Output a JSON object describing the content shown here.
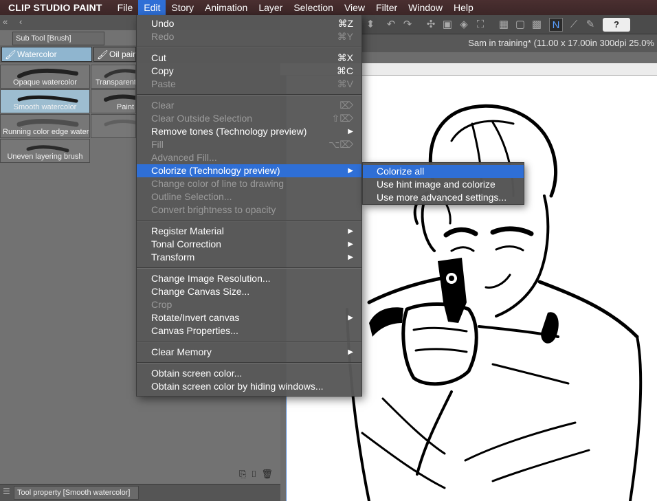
{
  "menubar": {
    "app_name": "CLIP STUDIO PAINT",
    "items": [
      "File",
      "Edit",
      "Story",
      "Animation",
      "Layer",
      "Selection",
      "View",
      "Filter",
      "Window",
      "Help"
    ],
    "active": "Edit"
  },
  "toolbar": {
    "help_label": "?"
  },
  "document": {
    "title": "Sam in training* (11.00 x 17.00in 300dpi 25.0%"
  },
  "subtool_panel": {
    "tab_label": "Sub Tool [Brush]",
    "tabs": [
      {
        "label": "Watercolor",
        "active": true
      },
      {
        "label": "Oil paint",
        "active": false
      }
    ],
    "brushes": [
      {
        "label": "Opaque watercolor",
        "selected": false
      },
      {
        "label": "Transparent watercolor",
        "selected": false
      },
      {
        "label": "Smooth watercolor",
        "selected": true
      },
      {
        "label": "Paint",
        "selected": false
      },
      {
        "label": "Running color edge watercolor",
        "selected": false
      },
      {
        "label": "Uneven layering brush",
        "selected": false
      }
    ]
  },
  "tool_property": {
    "tab_label": "Tool property [Smooth watercolor]"
  },
  "edit_menu": {
    "undo": {
      "label": "Undo",
      "shortcut": "⌘Z"
    },
    "redo": {
      "label": "Redo",
      "shortcut": "⌘Y"
    },
    "cut": {
      "label": "Cut",
      "shortcut": "⌘X"
    },
    "copy": {
      "label": "Copy",
      "shortcut": "⌘C"
    },
    "paste": {
      "label": "Paste",
      "shortcut": "⌘V"
    },
    "clear": {
      "label": "Clear",
      "shortcut": "⌦"
    },
    "clear_outside": {
      "label": "Clear Outside Selection",
      "shortcut": "⇧⌦"
    },
    "remove_tones": {
      "label": "Remove tones (Technology preview)"
    },
    "fill": {
      "label": "Fill",
      "shortcut": "⌥⌦"
    },
    "advanced_fill": {
      "label": "Advanced Fill..."
    },
    "colorize": {
      "label": "Colorize (Technology preview)"
    },
    "change_color_line": {
      "label": "Change color of line to drawing"
    },
    "outline_selection": {
      "label": "Outline Selection..."
    },
    "brightness_opacity": {
      "label": "Convert brightness to opacity"
    },
    "register_material": {
      "label": "Register Material"
    },
    "tonal_correction": {
      "label": "Tonal Correction"
    },
    "transform": {
      "label": "Transform"
    },
    "change_resolution": {
      "label": "Change Image Resolution..."
    },
    "change_canvas_size": {
      "label": "Change Canvas Size..."
    },
    "crop": {
      "label": "Crop"
    },
    "rotate_invert": {
      "label": "Rotate/Invert canvas"
    },
    "canvas_properties": {
      "label": "Canvas Properties..."
    },
    "clear_memory": {
      "label": "Clear Memory"
    },
    "obtain_screen_color": {
      "label": "Obtain screen color..."
    },
    "obtain_screen_color_hiding": {
      "label": "Obtain screen color by hiding windows..."
    }
  },
  "colorize_submenu": {
    "colorize_all": "Colorize all",
    "use_hint": "Use hint image and colorize",
    "advanced": "Use more advanced settings..."
  },
  "icons": {
    "undo": "undo-icon",
    "redo": "redo-icon",
    "pen_mode": "pen-mode-icon",
    "help": "help-icon"
  },
  "colors": {
    "menu_highlight": "#2f6fd6",
    "menubar_bg": "#3c2627",
    "selected_brush": "#9dbdd0"
  }
}
